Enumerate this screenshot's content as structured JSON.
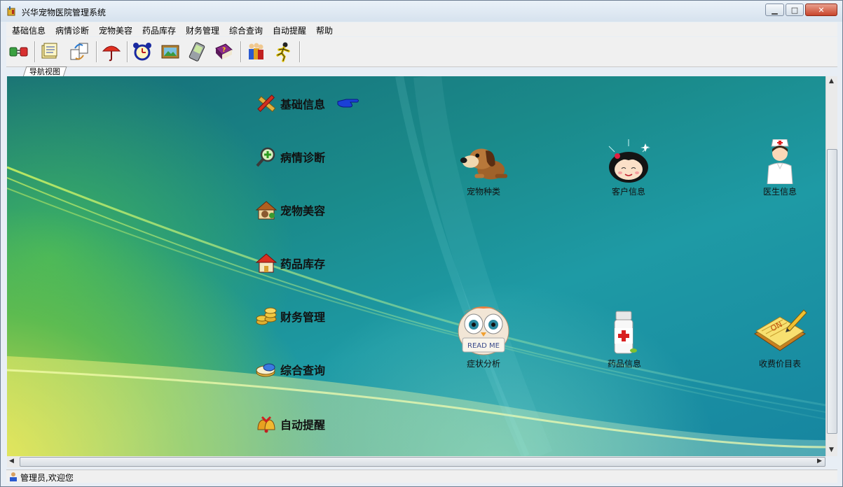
{
  "window": {
    "title": "兴华宠物医院管理系统"
  },
  "menu": [
    "基础信息",
    "病情诊断",
    "宠物美容",
    "药品库存",
    "财务管理",
    "综合查询",
    "自动提醒",
    "帮助"
  ],
  "tab": {
    "label": "导航视图"
  },
  "nav": [
    {
      "label": "基础信息",
      "icon": "pencil-ruler-icon"
    },
    {
      "label": "病情诊断",
      "icon": "magnifier-plus-icon"
    },
    {
      "label": "宠物美容",
      "icon": "pet-house-icon"
    },
    {
      "label": "药品库存",
      "icon": "house-icon"
    },
    {
      "label": "财务管理",
      "icon": "coins-icon"
    },
    {
      "label": "综合查询",
      "icon": "pills-icon"
    },
    {
      "label": "自动提醒",
      "icon": "bells-icon"
    }
  ],
  "functions": [
    {
      "label": "宠物种类",
      "icon": "dog-icon"
    },
    {
      "label": "客户信息",
      "icon": "girl-face-icon"
    },
    {
      "label": "医生信息",
      "icon": "nurse-icon"
    },
    {
      "label": "症状分析",
      "icon": "owl-read-me-icon"
    },
    {
      "label": "药品信息",
      "icon": "medicine-bottle-icon"
    },
    {
      "label": "收费价目表",
      "icon": "notepad-icon"
    }
  ],
  "status": {
    "text": "管理员,欢迎您"
  },
  "colors": {
    "accent_blue": "#1a3fd6",
    "titlebar_close": "#c9462c"
  }
}
